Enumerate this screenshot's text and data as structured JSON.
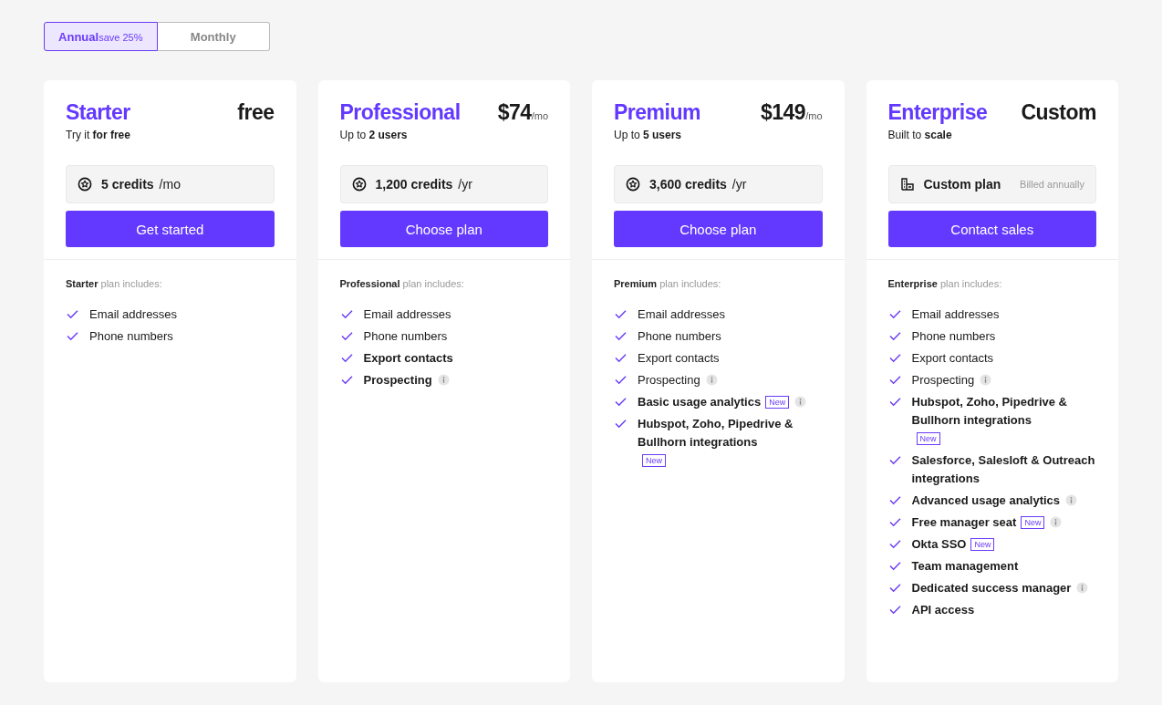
{
  "billing_toggle": [
    {
      "label": "Annual",
      "note": "save 25%",
      "selected": true
    },
    {
      "label": "Monthly",
      "selected": false
    }
  ],
  "plans": [
    {
      "name": "Starter",
      "price": "free",
      "subtitle": "Try it **for free**",
      "allowance": {
        "kind": "credits",
        "amount": "5 credits",
        "unit": "/mo"
      },
      "button": "Get started",
      "includes": "**Starter** plan includes:",
      "features": [
        {
          "text": "Email addresses",
          "bold": false
        },
        {
          "text": "Phone numbers",
          "bold": false
        }
      ]
    },
    {
      "name": "Professional",
      "price": "$74",
      "period": "/mo",
      "subtitle": "Up to **2 users**",
      "allowance": {
        "kind": "credits",
        "amount": "1,200 credits",
        "unit": "/yr"
      },
      "button": "Choose plan",
      "includes": "**Professional** plan includes:",
      "features": [
        {
          "text": "Email addresses",
          "bold": false
        },
        {
          "text": "Phone numbers",
          "bold": false
        },
        {
          "text": "Export contacts",
          "bold": true
        },
        {
          "text": "Prospecting",
          "bold": true,
          "info": true
        }
      ]
    },
    {
      "name": "Premium",
      "price": "$149",
      "period": "/mo",
      "subtitle": "Up to **5 users**",
      "allowance": {
        "kind": "credits",
        "amount": "3,600 credits",
        "unit": "/yr"
      },
      "button": "Choose plan",
      "includes": "**Premium** plan includes:",
      "features": [
        {
          "text": "Email addresses",
          "bold": false
        },
        {
          "text": "Phone numbers",
          "bold": false
        },
        {
          "text": "Export contacts",
          "bold": false
        },
        {
          "text": "Prospecting",
          "bold": false,
          "info": true
        },
        {
          "text": "Basic usage analytics",
          "bold": true,
          "badge": "New",
          "info": true
        },
        {
          "text": "Hubspot, Zoho, Pipedrive & Bullhorn integrations",
          "bold": true,
          "badge": "New"
        }
      ]
    },
    {
      "name": "Enterprise",
      "price": "Custom",
      "subtitle": "Built to **scale**",
      "allowance": {
        "kind": "custom",
        "amount": "Custom plan",
        "note": "Billed annually"
      },
      "button": "Contact sales",
      "includes": "**Enterprise** plan includes:",
      "features": [
        {
          "text": "Email addresses",
          "bold": false
        },
        {
          "text": "Phone numbers",
          "bold": false
        },
        {
          "text": "Export contacts",
          "bold": false
        },
        {
          "text": "Prospecting",
          "bold": false,
          "info": true
        },
        {
          "text": "Hubspot, Zoho, Pipedrive & Bullhorn integrations",
          "bold": true,
          "badge": "New"
        },
        {
          "text": "Salesforce, Salesloft & Outreach integrations",
          "bold": true
        },
        {
          "text": "Advanced usage analytics",
          "bold": true,
          "info": true
        },
        {
          "text": "Free manager seat",
          "bold": true,
          "badge": "New",
          "info": true
        },
        {
          "text": "Okta SSO",
          "bold": true,
          "badge": "New"
        },
        {
          "text": "Team management",
          "bold": true
        },
        {
          "text": "Dedicated success manager",
          "bold": true,
          "info": true
        },
        {
          "text": "API access",
          "bold": true
        }
      ]
    }
  ]
}
